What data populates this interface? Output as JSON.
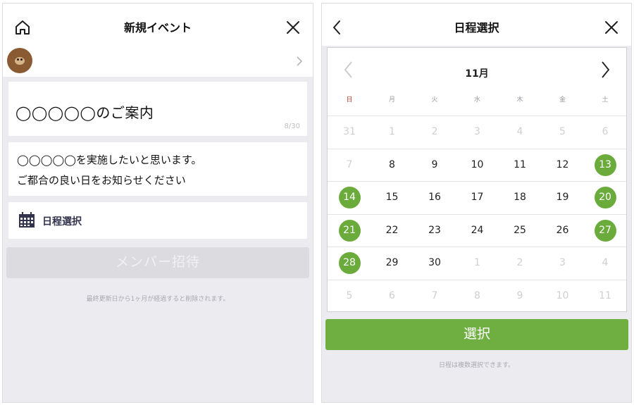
{
  "left": {
    "header": {
      "title": "新規イベント",
      "left_icon": "home-icon",
      "right_icon": "close-icon"
    },
    "event_title": {
      "value": "◯◯◯◯◯のご案内",
      "counter": "8/30"
    },
    "description": {
      "line1": "◯◯◯◯◯を実施したいと思います。",
      "line2": "ご都合の良い日をお知らせください"
    },
    "date_select": {
      "icon": "calendar-icon",
      "label": "日程選択"
    },
    "invite_button": "メンバー招待",
    "note": "最終更新日から1ヶ月が経過すると削除されます。"
  },
  "right": {
    "header": {
      "title": "日程選択",
      "left_icon": "back-icon",
      "right_icon": "close-icon"
    },
    "calendar": {
      "month": "11月",
      "weekdays": [
        "日",
        "月",
        "火",
        "水",
        "木",
        "金",
        "土"
      ],
      "weekday_colors": {
        "sunday": "#c0392b",
        "default": "#9a9aa2"
      },
      "selected_color": "#6bab3c",
      "weeks": [
        [
          {
            "d": "31",
            "m": true
          },
          {
            "d": "1",
            "m": true
          },
          {
            "d": "2",
            "m": true
          },
          {
            "d": "3",
            "m": true
          },
          {
            "d": "4",
            "m": true
          },
          {
            "d": "5",
            "m": true
          },
          {
            "d": "6",
            "m": true
          }
        ],
        [
          {
            "d": "7",
            "m": true
          },
          {
            "d": "8"
          },
          {
            "d": "9"
          },
          {
            "d": "10"
          },
          {
            "d": "11"
          },
          {
            "d": "12"
          },
          {
            "d": "13",
            "s": true
          }
        ],
        [
          {
            "d": "14",
            "s": true
          },
          {
            "d": "15"
          },
          {
            "d": "16"
          },
          {
            "d": "17"
          },
          {
            "d": "18"
          },
          {
            "d": "19"
          },
          {
            "d": "20",
            "s": true
          }
        ],
        [
          {
            "d": "21",
            "s": true
          },
          {
            "d": "22"
          },
          {
            "d": "23"
          },
          {
            "d": "24"
          },
          {
            "d": "25"
          },
          {
            "d": "26"
          },
          {
            "d": "27",
            "s": true
          }
        ],
        [
          {
            "d": "28",
            "s": true
          },
          {
            "d": "29"
          },
          {
            "d": "30"
          },
          {
            "d": "1",
            "m": true
          },
          {
            "d": "2",
            "m": true
          },
          {
            "d": "3",
            "m": true
          },
          {
            "d": "4",
            "m": true
          }
        ],
        [
          {
            "d": "5",
            "m": true
          },
          {
            "d": "6",
            "m": true
          },
          {
            "d": "7",
            "m": true
          },
          {
            "d": "8",
            "m": true
          },
          {
            "d": "9",
            "m": true
          },
          {
            "d": "10",
            "m": true
          },
          {
            "d": "11",
            "m": true
          }
        ]
      ]
    },
    "select_button": "選択",
    "note": "日程は複数選択できます。"
  }
}
